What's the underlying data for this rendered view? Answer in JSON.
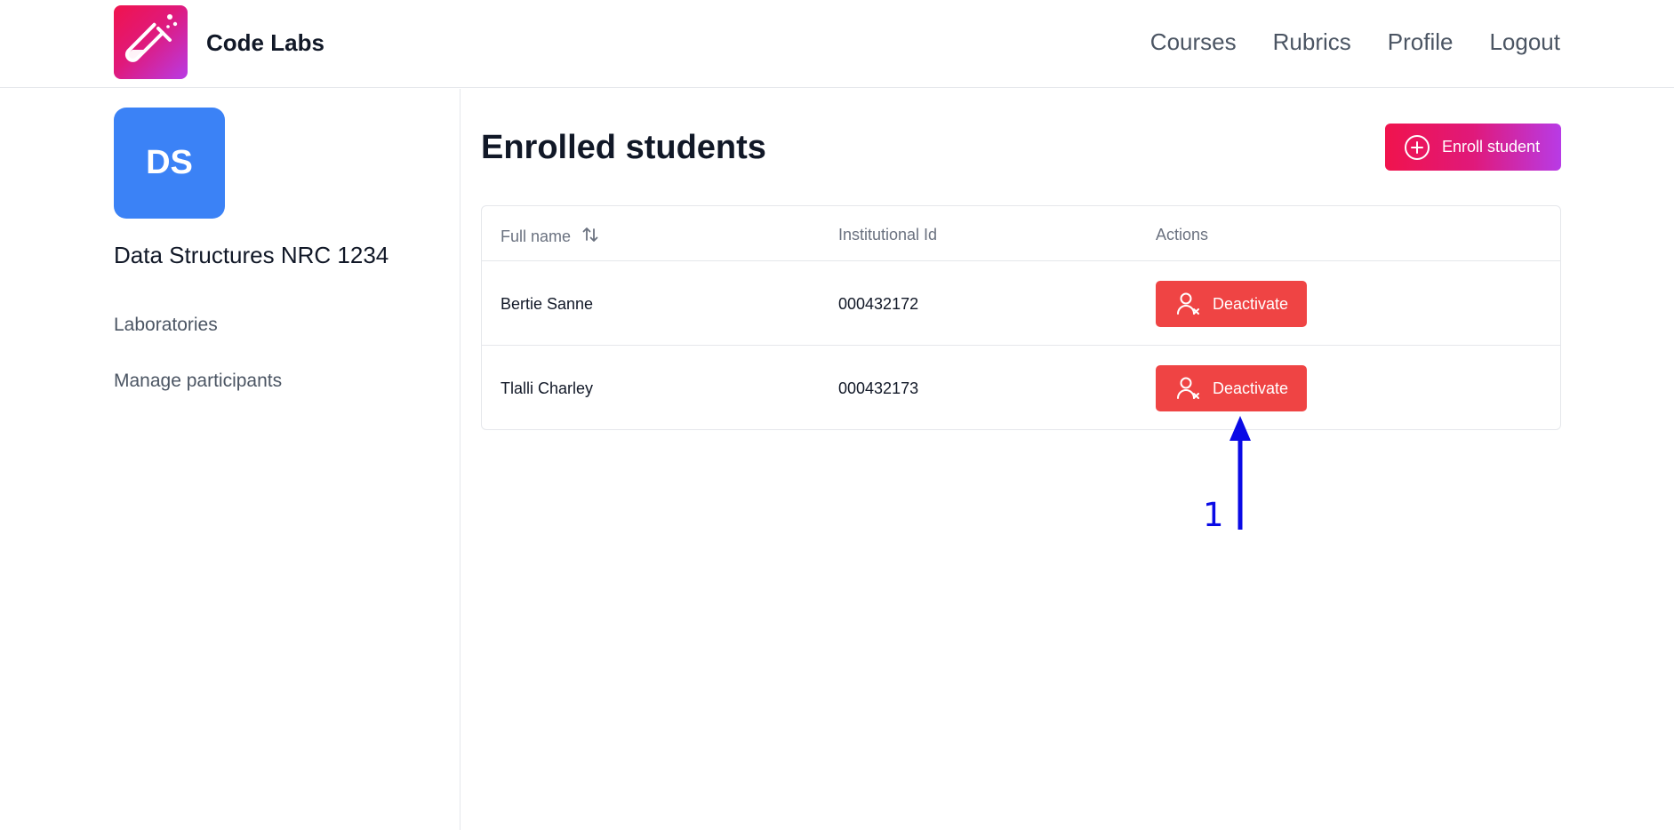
{
  "header": {
    "brand": "Code Labs",
    "logo_icon": "test-tube-icon",
    "nav": [
      "Courses",
      "Rubrics",
      "Profile",
      "Logout"
    ]
  },
  "sidebar": {
    "avatar_initials": "DS",
    "course_name": "Data Structures NRC 1234",
    "links": [
      "Laboratories",
      "Manage participants"
    ]
  },
  "main": {
    "title": "Enrolled students",
    "enroll_button": "Enroll student",
    "table": {
      "columns": [
        "Full name",
        "Institutional Id",
        "Actions"
      ],
      "rows": [
        {
          "name": "Bertie Sanne",
          "id": "000432172",
          "action": "Deactivate"
        },
        {
          "name": "Tlalli Charley",
          "id": "000432173",
          "action": "Deactivate"
        }
      ]
    }
  },
  "annotation": {
    "label": "1"
  },
  "colors": {
    "brand_gradient_start": "#f0134d",
    "brand_gradient_end": "#b83be6",
    "avatar": "#3b82f6",
    "danger": "#ef4444",
    "annotation": "#0a0ae6"
  }
}
